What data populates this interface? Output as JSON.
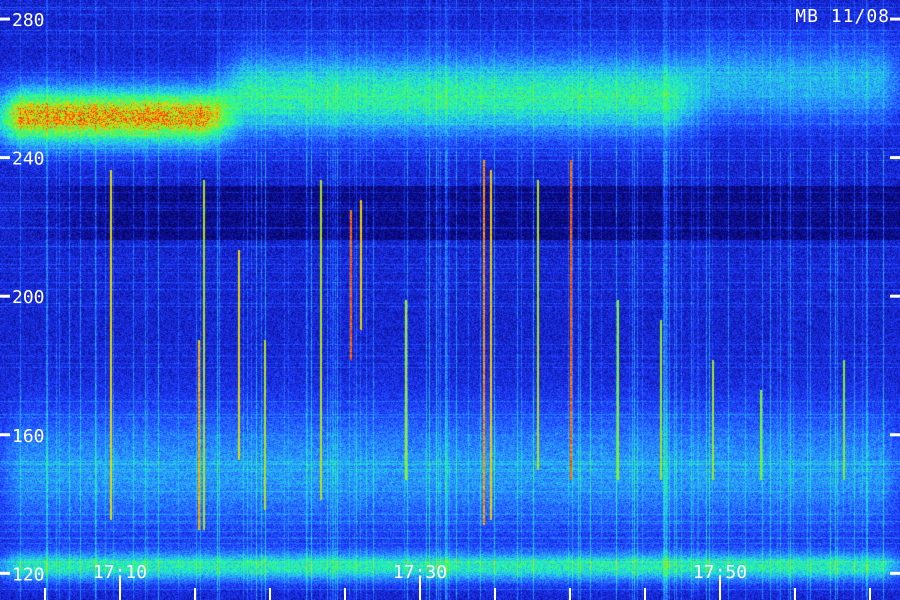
{
  "chart_data": {
    "type": "heatmap",
    "title": "",
    "corner_label": "MB 11/08",
    "xlabel": "",
    "ylabel": "",
    "x_tick_labels": [
      "17:10",
      "17:30",
      "17:50"
    ],
    "x_tick_minutes": [
      10,
      30,
      50
    ],
    "x_range_minutes": [
      2,
      62
    ],
    "y_tick_labels": [
      "120",
      "160",
      "200",
      "240",
      "280"
    ],
    "y_ticks": [
      120,
      160,
      200,
      240,
      280
    ],
    "y_range": [
      112.3,
      285.5
    ],
    "bands": [
      {
        "y_center": 252,
        "y_width": 16,
        "x_start_minute": 2,
        "x_end_minute": 17,
        "intensity": 0.95
      },
      {
        "y_center": 258,
        "y_width": 22,
        "x_start_minute": 17,
        "x_end_minute": 48,
        "intensity": 0.55
      },
      {
        "y_center": 262,
        "y_width": 22,
        "x_start_minute": 48,
        "x_end_minute": 62,
        "intensity": 0.35
      },
      {
        "y_center": 150,
        "y_width": 35,
        "x_start_minute": 2,
        "x_end_minute": 62,
        "intensity": 0.28
      },
      {
        "y_center": 122,
        "y_width": 8,
        "x_start_minute": 2,
        "x_end_minute": 62,
        "intensity": 0.5
      }
    ],
    "colormap": [
      "#000010",
      "#0a0a8c",
      "#1e3cff",
      "#2aa0ff",
      "#1ef0c8",
      "#50ff40",
      "#ffd000",
      "#ff3000"
    ]
  }
}
